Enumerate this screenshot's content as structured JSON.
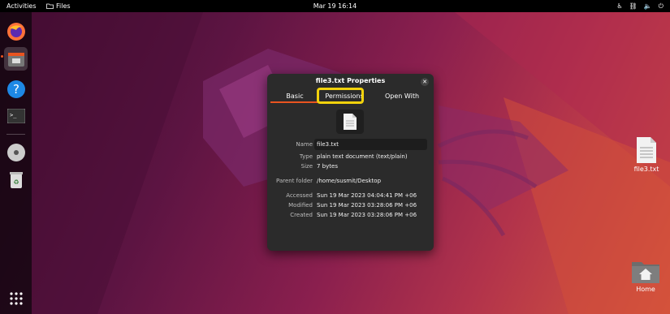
{
  "topbar": {
    "activities": "Activities",
    "app_name": "Files",
    "clock": "Mar 19  16:14"
  },
  "dialog": {
    "title": "file3.txt Properties",
    "tabs": [
      "Basic",
      "Permissions",
      "Open With"
    ],
    "name_label": "Name",
    "name_value": "file3.txt",
    "type_label": "Type",
    "type_value": "plain text document (text/plain)",
    "size_label": "Size",
    "size_value": "7 bytes",
    "parent_label": "Parent folder",
    "parent_value": "/home/susmit/Desktop",
    "accessed_label": "Accessed",
    "accessed_value": "Sun 19 Mar 2023 04:04:41 PM +06",
    "modified_label": "Modified",
    "modified_value": "Sun 19 Mar 2023 03:28:06 PM +06",
    "created_label": "Created",
    "created_value": "Sun 19 Mar 2023 03:28:06 PM +06"
  },
  "desktop": {
    "file_label": "file3.txt",
    "home_label": "Home"
  },
  "colors": {
    "accent": "#e95420",
    "highlight": "#f2d20c"
  }
}
